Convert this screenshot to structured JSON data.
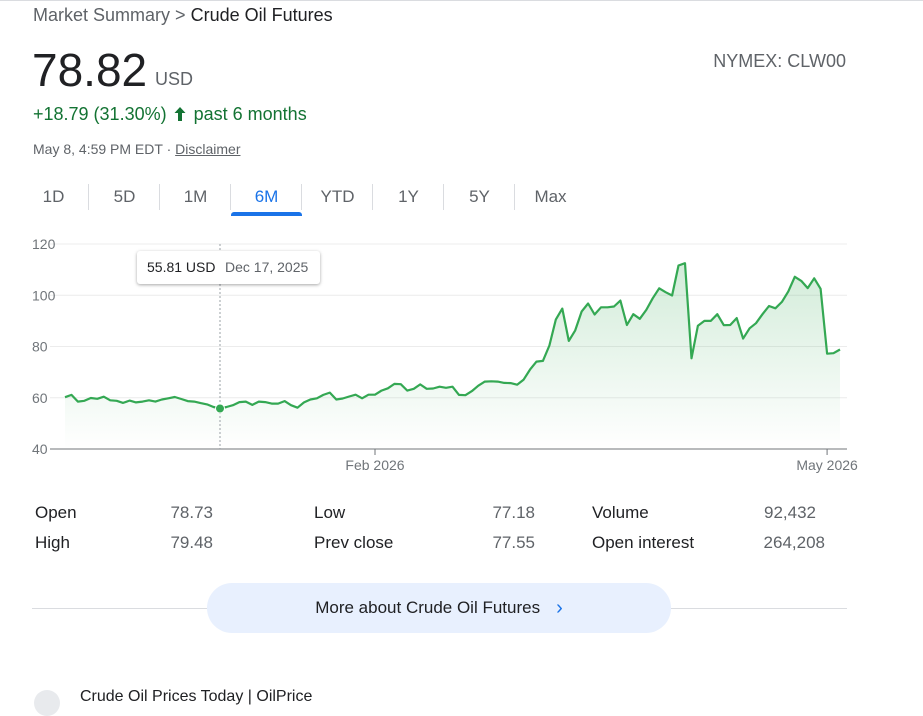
{
  "breadcrumb": {
    "parent": "Market Summary",
    "separator": ">",
    "current": "Crude Oil Futures"
  },
  "quote": {
    "price": "78.82",
    "currency": "USD",
    "exchange": "NYMEX: CLW00",
    "change": "+18.79 (31.30%)",
    "period": "past 6 months",
    "timestamp": "May 8, 4:59 PM EDT",
    "disclaimer": "Disclaimer",
    "timestamp_sep": "·"
  },
  "tabs": [
    {
      "label": "1D",
      "active": false
    },
    {
      "label": "5D",
      "active": false
    },
    {
      "label": "1M",
      "active": false
    },
    {
      "label": "6M",
      "active": true
    },
    {
      "label": "YTD",
      "active": false
    },
    {
      "label": "1Y",
      "active": false
    },
    {
      "label": "5Y",
      "active": false
    },
    {
      "label": "Max",
      "active": false
    }
  ],
  "tooltip": {
    "value": "55.81 USD",
    "date": "Dec 17, 2025"
  },
  "colors": {
    "line": "#34a853",
    "accent": "#1a73e8",
    "positive": "#137333"
  },
  "chart_data": {
    "type": "area",
    "y_ticks": [
      "120",
      "100",
      "80",
      "60",
      "40"
    ],
    "ylim": [
      40,
      120
    ],
    "x_tick_labels": [
      "Feb 2026",
      "May 2026"
    ],
    "grid": true,
    "highlight_point": {
      "date": "Dec 17, 2025",
      "value": 55.81
    },
    "series": [
      {
        "values": [
          60.2,
          61.1,
          58.5,
          58.8,
          59.9,
          59.6,
          60.4,
          59.0,
          58.8,
          58.0,
          58.9,
          58.2,
          58.5,
          59.0,
          58.5,
          59.3,
          59.8,
          60.3,
          59.5,
          58.7,
          58.5,
          57.9,
          57.4,
          56.4,
          55.81,
          56.4,
          57.1,
          58.3,
          58.5,
          57.2,
          58.5,
          58.3,
          57.7,
          57.7,
          58.7,
          57.1,
          56.1,
          58.2,
          59.3,
          59.8,
          61.1,
          62.0,
          59.3,
          59.7,
          60.5,
          61.2,
          59.8,
          61.2,
          61.2,
          62.8,
          63.7,
          65.4,
          65.3,
          62.8,
          63.5,
          65.2,
          63.5,
          63.6,
          64.3,
          63.9,
          64.3,
          61.1,
          61.0,
          62.6,
          64.7,
          66.3,
          66.4,
          66.3,
          65.8,
          65.7,
          65.1,
          67.0,
          71.0,
          74.1,
          74.4,
          80.4,
          90.5,
          94.8,
          82.2,
          86.3,
          93.7,
          96.8,
          92.5,
          95.3,
          95.3,
          95.6,
          97.9,
          88.4,
          92.6,
          90.8,
          94.3,
          98.8,
          102.7,
          101.2,
          99.9,
          111.6,
          112.5,
          75.4,
          88.1,
          90.0,
          90.0,
          92.6,
          88.3,
          88.4,
          91.1,
          83.1,
          87.1,
          89.1,
          92.6,
          95.8,
          94.9,
          97.4,
          101.5,
          107.2,
          105.6,
          102.8,
          106.6,
          102.5,
          77.18,
          77.4,
          78.82
        ]
      }
    ]
  },
  "stats": [
    {
      "label": "Open",
      "value": "78.73"
    },
    {
      "label": "High",
      "value": "79.48"
    },
    {
      "label": "Low",
      "value": "77.18"
    },
    {
      "label": "Prev close",
      "value": "77.55"
    },
    {
      "label": "Volume",
      "value": "92,432"
    },
    {
      "label": "Open interest",
      "value": "264,208"
    }
  ],
  "more_button": {
    "label": "More about Crude Oil Futures",
    "chevron": "›"
  },
  "next_section": {
    "label": "Crude Oil Prices Today | OilPrice"
  }
}
